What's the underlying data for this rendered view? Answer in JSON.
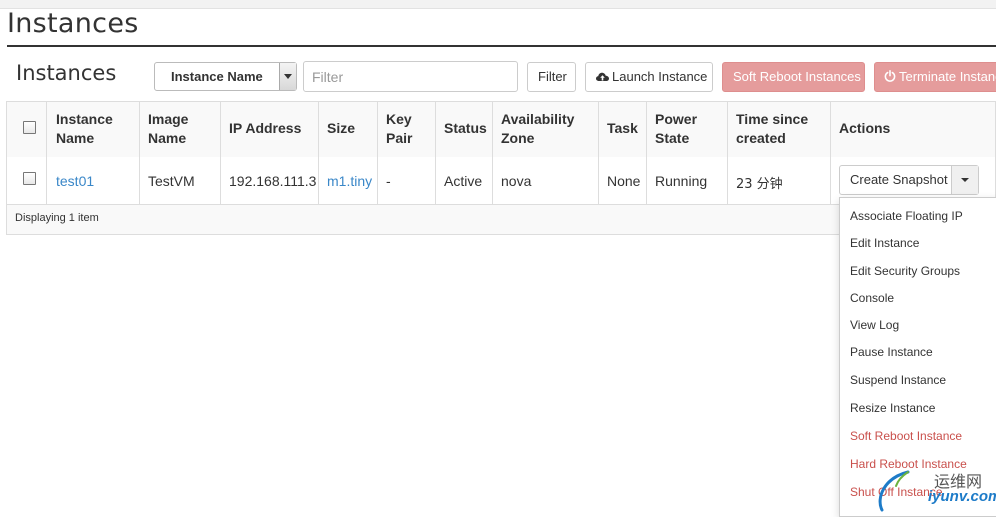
{
  "page": {
    "title": "Instances"
  },
  "table": {
    "title": "Instances",
    "filter_select": "Instance Name",
    "filter_placeholder": "Filter",
    "buttons": {
      "filter": "Filter",
      "launch": "Launch Instance",
      "soft_reboot": "Soft Reboot Instances",
      "terminate": "Terminate Instances"
    },
    "columns": [
      [
        "Instance",
        "Name"
      ],
      [
        "Image",
        "Name"
      ],
      [
        "IP Address"
      ],
      [
        "Size"
      ],
      [
        "Key",
        "Pair"
      ],
      [
        "Status"
      ],
      [
        "Availability",
        "Zone"
      ],
      [
        "Task"
      ],
      [
        "Power",
        "State"
      ],
      [
        "Time since",
        "created"
      ],
      [
        "Actions"
      ]
    ],
    "rows": [
      {
        "name": "test01",
        "image": "TestVM",
        "ip": "192.168.111.3",
        "size": "m1.tiny",
        "key_pair": "-",
        "status": "Active",
        "zone": "nova",
        "task": "None",
        "power": "Running",
        "time": "23 分钟",
        "action": "Create Snapshot"
      }
    ],
    "footer": "Displaying 1 item"
  },
  "actions_menu": [
    {
      "label": "Associate Floating IP",
      "danger": false
    },
    {
      "label": "Edit Instance",
      "danger": false
    },
    {
      "label": "Edit Security Groups",
      "danger": false
    },
    {
      "label": "Console",
      "danger": false
    },
    {
      "label": "View Log",
      "danger": false
    },
    {
      "label": "Pause Instance",
      "danger": false
    },
    {
      "label": "Suspend Instance",
      "danger": false
    },
    {
      "label": "Resize Instance",
      "danger": false
    },
    {
      "label": "Soft Reboot Instance",
      "danger": true
    },
    {
      "label": "Hard Reboot Instance",
      "danger": true
    },
    {
      "label": "Shut Off Instance",
      "danger": true
    }
  ],
  "watermark": {
    "cn": "运维网",
    "en": "iyunv.com"
  },
  "colors": {
    "link": "#3a87c8",
    "danger": "#c9504c",
    "danger_button": "#e59c9c"
  },
  "icons": {
    "launch": "cloud-upload-icon",
    "terminate": "power-icon",
    "dropdown": "caret-down-icon"
  }
}
